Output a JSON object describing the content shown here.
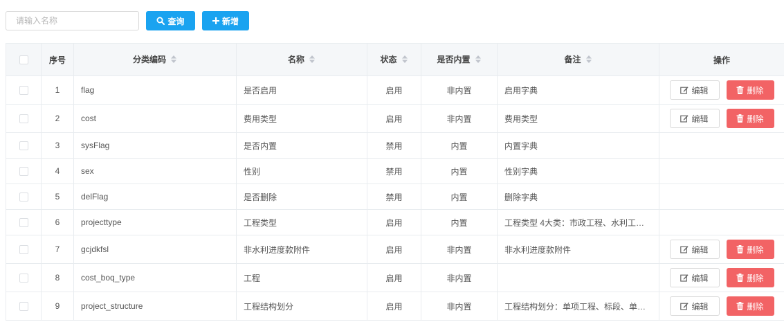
{
  "toolbar": {
    "search_placeholder": "请输入名称",
    "query_label": "查询",
    "add_label": "新增"
  },
  "table": {
    "headers": {
      "index": "序号",
      "code": "分类编码",
      "name": "名称",
      "status": "状态",
      "builtin": "是否内置",
      "remark": "备注",
      "ops": "操作"
    },
    "edit_label": "编辑",
    "delete_label": "删除",
    "rows": [
      {
        "idx": "1",
        "code": "flag",
        "name": "是否启用",
        "status": "启用",
        "builtin": "非内置",
        "remark": "启用字典",
        "ops": true
      },
      {
        "idx": "2",
        "code": "cost",
        "name": "费用类型",
        "status": "启用",
        "builtin": "非内置",
        "remark": "费用类型",
        "ops": true
      },
      {
        "idx": "3",
        "code": "sysFlag",
        "name": "是否内置",
        "status": "禁用",
        "builtin": "内置",
        "remark": "内置字典",
        "ops": false
      },
      {
        "idx": "4",
        "code": "sex",
        "name": "性别",
        "status": "禁用",
        "builtin": "内置",
        "remark": "性别字典",
        "ops": false
      },
      {
        "idx": "5",
        "code": "delFlag",
        "name": "是否删除",
        "status": "禁用",
        "builtin": "内置",
        "remark": "删除字典",
        "ops": false
      },
      {
        "idx": "6",
        "code": "projecttype",
        "name": "工程类型",
        "status": "启用",
        "builtin": "内置",
        "remark": "工程类型 4大类：市政工程、水利工…",
        "ops": false
      },
      {
        "idx": "7",
        "code": "gcjdkfsl",
        "name": "非水利进度款附件",
        "status": "启用",
        "builtin": "非内置",
        "remark": "非水利进度款附件",
        "ops": true
      },
      {
        "idx": "8",
        "code": "cost_boq_type",
        "name": "工程",
        "status": "启用",
        "builtin": "非内置",
        "remark": "",
        "ops": true
      },
      {
        "idx": "9",
        "code": "project_structure",
        "name": "工程结构划分",
        "status": "启用",
        "builtin": "非内置",
        "remark": "工程结构划分：单项工程、标段、单…",
        "ops": true
      }
    ]
  },
  "colors": {
    "primary": "#1aa3f0",
    "danger": "#f26365",
    "header_bg": "#f5f7f9",
    "border": "#e8ecef"
  },
  "icons": {
    "query": "search-icon",
    "add": "plus-icon",
    "sort": "sort-icon",
    "edit": "edit-icon",
    "delete": "trash-icon"
  }
}
